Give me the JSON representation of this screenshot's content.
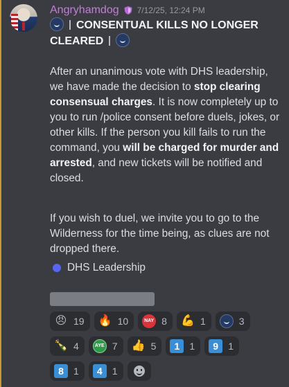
{
  "message": {
    "author": "Angryhamdog",
    "timestamp": "7/12/25, 12:24 PM",
    "title_text": "CONSENTUAL KILLS NO LONGER CLEARED",
    "paragraph1": {
      "t1": "After an unanimous vote with DHS leadership, we have made the decision to ",
      "b1": "stop clearing consensual charges",
      "t2": ". It is now completely up to you to run /police consent before duels, jokes, or other kills. If the person you kill fails to run the command, you ",
      "b2": "will be charged for murder and arrested",
      "t3": ", and new tickets will be notified and closed."
    },
    "paragraph2": "If you wish to duel, we invite you to go to the Wilderness for the time being, as clues are not dropped there.",
    "signature": "DHS Leadership"
  },
  "reactions": [
    [
      {
        "icon": "angry-face-icon",
        "glyph": "😠",
        "count": "19"
      },
      {
        "icon": "fire-icon",
        "glyph": "🔥",
        "count": "10"
      },
      {
        "icon": "nay-badge-icon",
        "glyph": "NAY",
        "count": "8"
      },
      {
        "icon": "flexed-biceps-icon",
        "glyph": "💪",
        "count": "1"
      },
      {
        "icon": "dhs-seal-icon",
        "glyph": "",
        "count": "3"
      }
    ],
    [
      {
        "icon": "bottle-icon",
        "glyph": "🍾",
        "count": "4"
      },
      {
        "icon": "aye-badge-icon",
        "glyph": "AYE",
        "count": "7"
      },
      {
        "icon": "thumbs-up-icon",
        "glyph": "👍",
        "count": "5"
      },
      {
        "icon": "keycap-1-icon",
        "glyph": "1",
        "count": "1"
      },
      {
        "icon": "keycap-9-icon",
        "glyph": "9",
        "count": "1"
      }
    ],
    [
      {
        "icon": "keycap-8-icon",
        "glyph": "8",
        "count": "1"
      },
      {
        "icon": "keycap-4-icon",
        "glyph": "4",
        "count": "1"
      }
    ]
  ],
  "colors": {
    "background": "#3a3c42",
    "username": "#c27ed6",
    "accent_bar": "#c99a2e",
    "signature_dot": "#5865f2"
  }
}
